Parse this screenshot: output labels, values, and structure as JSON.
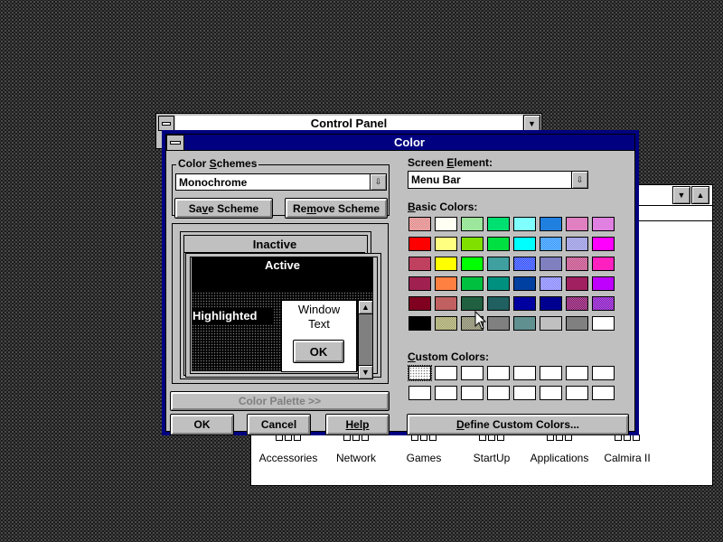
{
  "control_panel": {
    "title": "Control Panel"
  },
  "program_group": {
    "icons": [
      {
        "label": "Accessories"
      },
      {
        "label": "Network"
      },
      {
        "label": "Games"
      },
      {
        "label": "StartUp"
      },
      {
        "label": "Applications"
      },
      {
        "label": "Calmira II"
      }
    ]
  },
  "dialog": {
    "title": "Color",
    "color_schemes_label_pre": "Color ",
    "color_schemes_label_ul": "S",
    "color_schemes_label_post": "chemes",
    "scheme_value": "Monochrome",
    "save_scheme_pre": "Sa",
    "save_scheme_ul": "v",
    "save_scheme_post": "e Scheme",
    "remove_scheme_pre": "Re",
    "remove_scheme_ul": "m",
    "remove_scheme_post": "ove Scheme",
    "preview": {
      "inactive": "Inactive",
      "active": "Active",
      "highlighted": "Highlighted",
      "window_text_line1": "Window",
      "window_text_line2": "Text",
      "ok": "OK"
    },
    "color_palette": "Color Palette >>",
    "ok": "OK",
    "cancel": "Cancel",
    "help": "Help",
    "screen_element_pre": "Screen ",
    "screen_element_ul": "E",
    "screen_element_post": "lement:",
    "screen_element_value": "Menu Bar",
    "basic_colors_ul": "B",
    "basic_colors_post": "asic Colors:",
    "custom_colors_ul": "C",
    "custom_colors_post": "ustom Colors:",
    "define_custom_pre": "",
    "define_custom_ul": "D",
    "define_custom_post": "efine Custom Colors...",
    "basic_colors": [
      [
        "#e08080",
        "#fffff0",
        "#80e080",
        "#00e070",
        "#80ffff",
        "#2080e0",
        "#e080c0",
        "#e080e0"
      ],
      [
        "#ff0000",
        "#ffff80",
        "#80e000",
        "#00e040",
        "#00ffff",
        "#2090ff",
        "#9090e0",
        "#ff00ff"
      ],
      [
        "#c04060",
        "#ffff00",
        "#00ff00",
        "#40a0a0",
        "#2040ff",
        "#8080c0",
        "#c04080",
        "#ff20c0"
      ],
      [
        "#a02050",
        "#ff8040",
        "#00c040",
        "#009080",
        "#0040a0",
        "#8080ff",
        "#a02060",
        "#c000ff"
      ],
      [
        "#800020",
        "#c06060",
        "#206040",
        "#206060",
        "#0000a0",
        "#000090",
        "#800060",
        "#8000c0"
      ],
      [
        "#000000",
        "#a0a060",
        "#808060",
        "#808080",
        "#609090",
        "#c0c0c0",
        "#808080",
        "#ffffff"
      ]
    ],
    "dithered_cells": [
      "0-0",
      "0-1",
      "0-2",
      "1-5",
      "1-6",
      "2-4",
      "2-6",
      "3-5",
      "4-6",
      "4-7",
      "5-1",
      "5-2"
    ]
  }
}
